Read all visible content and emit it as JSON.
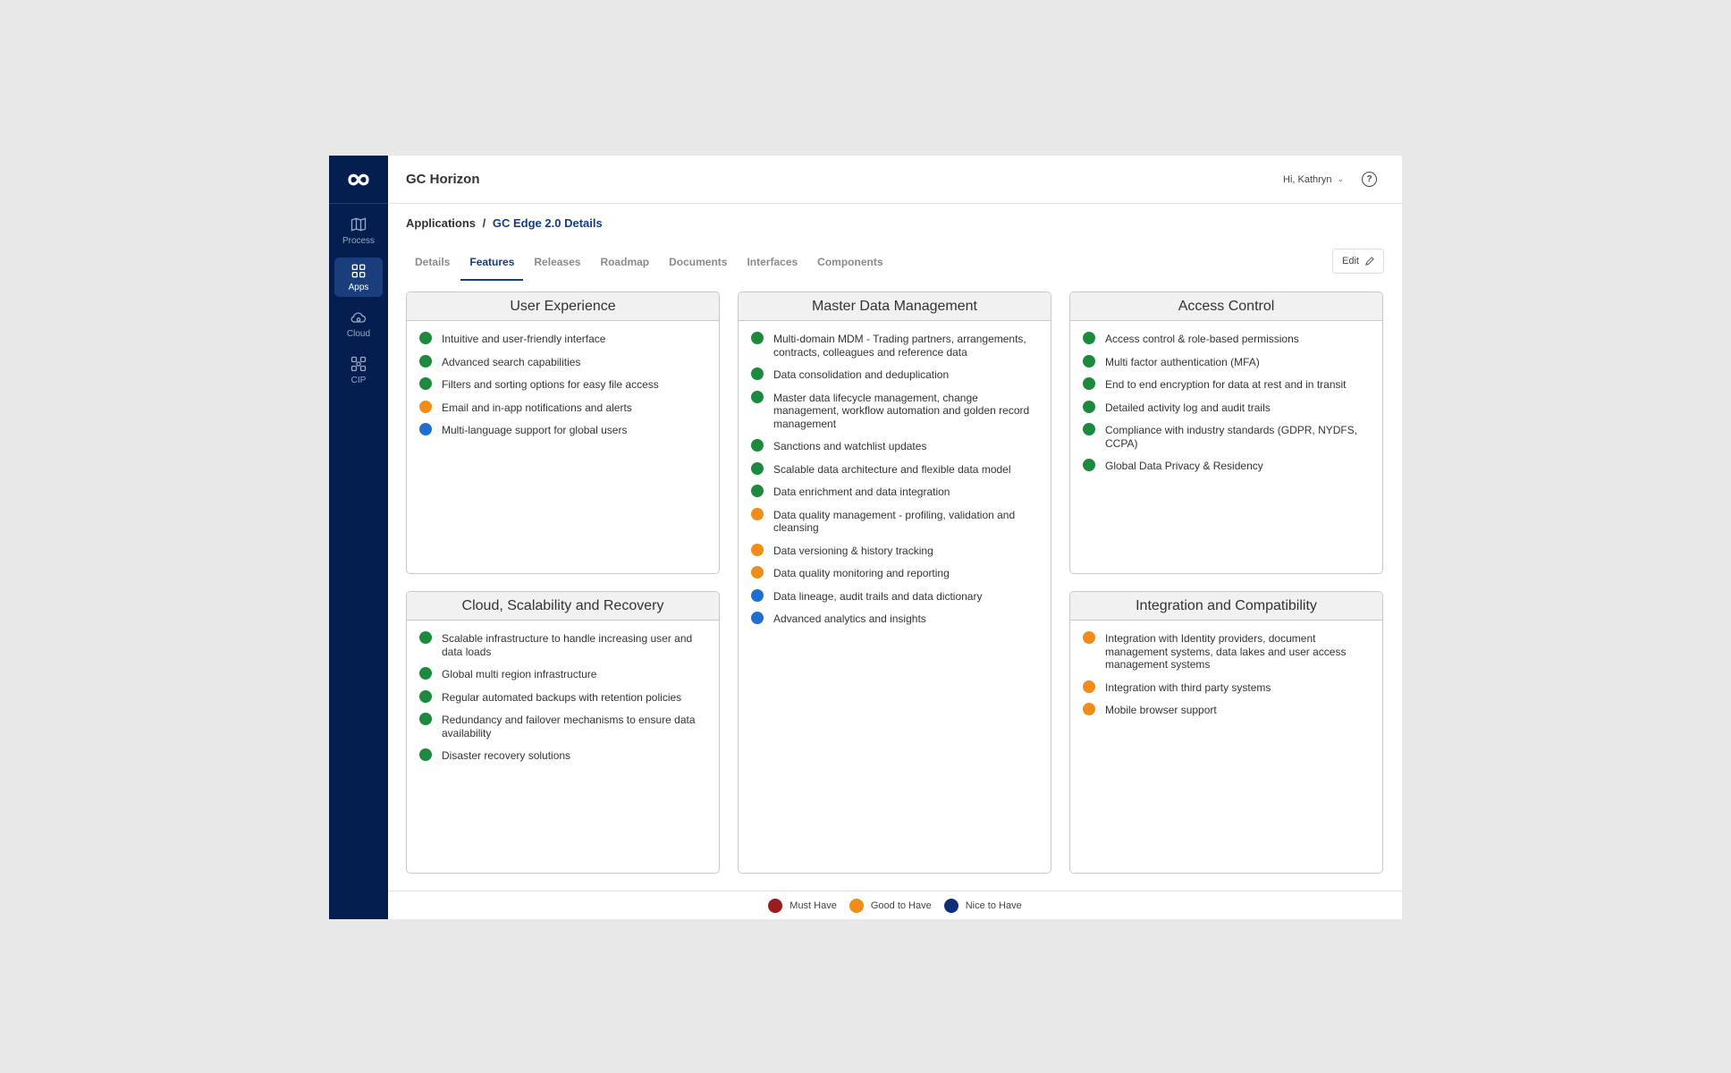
{
  "colors": {
    "must_have": "#9b1c1c",
    "good_to_have": "#f28c18",
    "nice_to_have": "#0f2e7a",
    "green": "#1b8a3d",
    "blue": "#1f6fd1"
  },
  "sidebar": {
    "items": [
      {
        "label": "Process",
        "icon": "map-icon"
      },
      {
        "label": "Apps",
        "icon": "grid-icon",
        "active": true
      },
      {
        "label": "Cloud",
        "icon": "cloud-icon"
      },
      {
        "label": "CIP",
        "icon": "cip-icon"
      }
    ]
  },
  "header": {
    "title": "GC Horizon",
    "user_greeting": "Hi, Kathryn",
    "help_glyph": "?"
  },
  "breadcrumb": {
    "root": "Applications",
    "separator": "/",
    "current": "GC Edge 2.0 Details"
  },
  "tabs": [
    "Details",
    "Features",
    "Releases",
    "Roadmap",
    "Documents",
    "Interfaces",
    "Components"
  ],
  "active_tab": "Features",
  "edit_label": "Edit",
  "cards": [
    {
      "title": "User Experience",
      "features": [
        {
          "text": "Intuitive and user-friendly interface",
          "color": "green"
        },
        {
          "text": "Advanced search capabilities",
          "color": "green"
        },
        {
          "text": "Filters and sorting options for easy file access",
          "color": "green"
        },
        {
          "text": "Email and in-app notifications and alerts",
          "color": "orange"
        },
        {
          "text": "Multi-language support for global users",
          "color": "blue"
        }
      ]
    },
    {
      "title": "Master Data Management",
      "features": [
        {
          "text": "Multi-domain MDM - Trading partners, arrangements, contracts, colleagues and reference data",
          "color": "green"
        },
        {
          "text": "Data consolidation and deduplication",
          "color": "green"
        },
        {
          "text": "Master data lifecycle management, change management, workflow automation and golden record management",
          "color": "green"
        },
        {
          "text": "Sanctions and watchlist updates",
          "color": "green"
        },
        {
          "text": "Scalable data architecture and flexible data model",
          "color": "green"
        },
        {
          "text": "Data enrichment and data integration",
          "color": "green"
        },
        {
          "text": "Data quality management - profiling, validation and cleansing",
          "color": "orange"
        },
        {
          "text": "Data versioning & history tracking",
          "color": "orange"
        },
        {
          "text": "Data quality monitoring and reporting",
          "color": "orange"
        },
        {
          "text": "Data lineage, audit trails and data dictionary",
          "color": "blue"
        },
        {
          "text": "Advanced analytics and insights",
          "color": "blue"
        }
      ]
    },
    {
      "title": "Access Control",
      "features": [
        {
          "text": "Access control & role-based permissions",
          "color": "green"
        },
        {
          "text": "Multi factor authentication (MFA)",
          "color": "green"
        },
        {
          "text": "End to end encryption for data at rest and in transit",
          "color": "green"
        },
        {
          "text": "Detailed activity log and audit trails",
          "color": "green"
        },
        {
          "text": "Compliance with industry standards (GDPR, NYDFS, CCPA)",
          "color": "green"
        },
        {
          "text": "Global Data Privacy & Residency",
          "color": "green"
        }
      ]
    },
    {
      "title": "Cloud, Scalability and Recovery",
      "features": [
        {
          "text": "Scalable infrastructure to handle increasing user and data loads",
          "color": "green"
        },
        {
          "text": "Global multi region infrastructure",
          "color": "green"
        },
        {
          "text": "Regular automated backups with retention policies",
          "color": "green"
        },
        {
          "text": "Redundancy and failover mechanisms to ensure data availability",
          "color": "green"
        },
        {
          "text": "Disaster recovery solutions",
          "color": "green"
        }
      ]
    },
    {
      "title": "Integration and Compatibility",
      "features": [
        {
          "text": "Integration with Identity providers, document management systems, data lakes and user access management systems",
          "color": "orange"
        },
        {
          "text": "Integration with third party systems",
          "color": "orange"
        },
        {
          "text": "Mobile browser support",
          "color": "orange"
        }
      ]
    }
  ],
  "legend": [
    {
      "label": "Must Have",
      "color": "#9b1c1c"
    },
    {
      "label": "Good to Have",
      "color": "#f28c18"
    },
    {
      "label": "Nice to Have",
      "color": "#0f2e7a"
    }
  ]
}
